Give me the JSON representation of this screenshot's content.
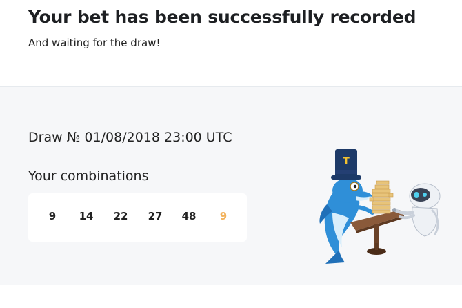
{
  "header": {
    "title": "Your bet has been successfully recorded",
    "subtitle": "And waiting for the draw!"
  },
  "draw": {
    "label": "Draw № 01/08/2018 23:00 UTC"
  },
  "combinations": {
    "label": "Your combinations",
    "numbers": [
      "9",
      "14",
      "22",
      "27",
      "48"
    ],
    "bonus": "9",
    "bonus_color": "#f2b15a"
  },
  "illustration": {
    "hat_letter": "T"
  }
}
